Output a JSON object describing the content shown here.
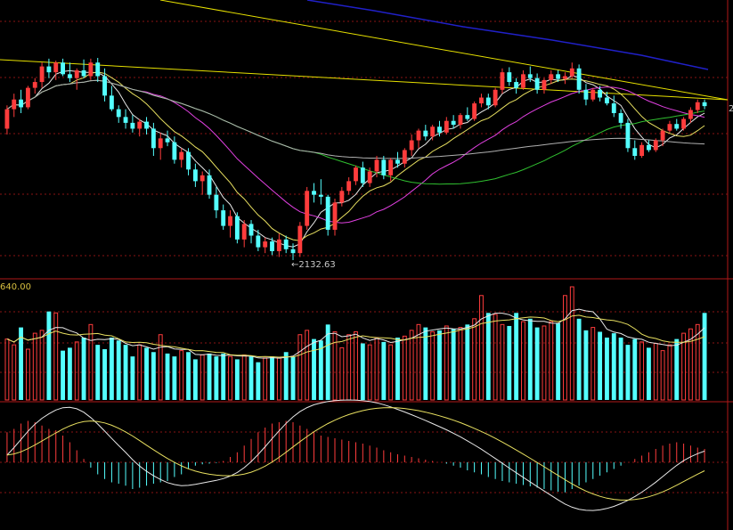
{
  "chart_data": [
    {
      "type": "candlestick",
      "panel": "price",
      "low_marker_text": "←2132.63",
      "right_edge_label": "2",
      "colors": {
        "up": "#ff3c3c",
        "down": "#54ffff",
        "ma5": "#e8e8e8",
        "ma10": "#e8e060",
        "ma20": "#e040e0",
        "ma60": "#30c030",
        "ma120": "#b0b0b0",
        "trend_yellow": "#e6e000",
        "trend_blue": "#2020c8"
      },
      "ohlc": [
        [
          2470,
          2530,
          2455,
          2520
        ],
        [
          2520,
          2560,
          2500,
          2545
        ],
        [
          2545,
          2570,
          2510,
          2525
        ],
        [
          2525,
          2580,
          2520,
          2575
        ],
        [
          2575,
          2600,
          2560,
          2590
        ],
        [
          2590,
          2640,
          2575,
          2630
        ],
        [
          2630,
          2650,
          2600,
          2615
        ],
        [
          2615,
          2645,
          2595,
          2640
        ],
        [
          2640,
          2650,
          2605,
          2610
        ],
        [
          2610,
          2640,
          2590,
          2600
        ],
        [
          2600,
          2625,
          2570,
          2620
        ],
        [
          2620,
          2648,
          2600,
          2605
        ],
        [
          2605,
          2650,
          2595,
          2640
        ],
        [
          2640,
          2652,
          2590,
          2605
        ],
        [
          2605,
          2625,
          2540,
          2555
        ],
        [
          2555,
          2580,
          2515,
          2520
        ],
        [
          2520,
          2530,
          2485,
          2500
        ],
        [
          2500,
          2520,
          2470,
          2485
        ],
        [
          2485,
          2505,
          2460,
          2470
        ],
        [
          2470,
          2495,
          2450,
          2488
        ],
        [
          2488,
          2500,
          2455,
          2470
        ],
        [
          2470,
          2485,
          2400,
          2420
        ],
        [
          2420,
          2460,
          2390,
          2445
        ],
        [
          2445,
          2465,
          2425,
          2435
        ],
        [
          2435,
          2450,
          2380,
          2390
        ],
        [
          2390,
          2420,
          2370,
          2410
        ],
        [
          2410,
          2420,
          2350,
          2365
        ],
        [
          2365,
          2380,
          2320,
          2335
        ],
        [
          2335,
          2360,
          2300,
          2350
        ],
        [
          2350,
          2365,
          2290,
          2300
        ],
        [
          2300,
          2320,
          2240,
          2260
        ],
        [
          2260,
          2275,
          2210,
          2220
        ],
        [
          2220,
          2260,
          2190,
          2245
        ],
        [
          2245,
          2255,
          2175,
          2185
        ],
        [
          2185,
          2235,
          2165,
          2225
        ],
        [
          2225,
          2235,
          2175,
          2195
        ],
        [
          2195,
          2210,
          2155,
          2165
        ],
        [
          2165,
          2190,
          2150,
          2180
        ],
        [
          2180,
          2190,
          2145,
          2155
        ],
        [
          2155,
          2200,
          2140,
          2185
        ],
        [
          2185,
          2195,
          2150,
          2160
        ],
        [
          2160,
          2175,
          2132,
          2150
        ],
        [
          2150,
          2230,
          2140,
          2220
        ],
        [
          2220,
          2320,
          2210,
          2310
        ],
        [
          2310,
          2330,
          2280,
          2300
        ],
        [
          2300,
          2340,
          2275,
          2295
        ],
        [
          2295,
          2300,
          2195,
          2210
        ],
        [
          2210,
          2290,
          2195,
          2280
        ],
        [
          2280,
          2320,
          2270,
          2310
        ],
        [
          2310,
          2345,
          2300,
          2335
        ],
        [
          2335,
          2375,
          2325,
          2370
        ],
        [
          2370,
          2385,
          2320,
          2330
        ],
        [
          2330,
          2370,
          2320,
          2360
        ],
        [
          2360,
          2400,
          2345,
          2390
        ],
        [
          2390,
          2400,
          2340,
          2350
        ],
        [
          2350,
          2395,
          2335,
          2390
        ],
        [
          2390,
          2410,
          2370,
          2380
        ],
        [
          2380,
          2420,
          2370,
          2415
        ],
        [
          2415,
          2455,
          2400,
          2440
        ],
        [
          2440,
          2470,
          2420,
          2465
        ],
        [
          2465,
          2480,
          2440,
          2450
        ],
        [
          2450,
          2480,
          2440,
          2475
        ],
        [
          2475,
          2490,
          2450,
          2460
        ],
        [
          2460,
          2500,
          2455,
          2490
        ],
        [
          2490,
          2505,
          2470,
          2480
        ],
        [
          2480,
          2510,
          2470,
          2505
        ],
        [
          2505,
          2525,
          2490,
          2495
        ],
        [
          2495,
          2540,
          2490,
          2535
        ],
        [
          2535,
          2560,
          2525,
          2550
        ],
        [
          2550,
          2560,
          2520,
          2530
        ],
        [
          2530,
          2575,
          2525,
          2570
        ],
        [
          2570,
          2625,
          2560,
          2615
        ],
        [
          2615,
          2628,
          2580,
          2590
        ],
        [
          2590,
          2600,
          2560,
          2575
        ],
        [
          2575,
          2620,
          2570,
          2610
        ],
        [
          2610,
          2630,
          2590,
          2600
        ],
        [
          2600,
          2612,
          2560,
          2570
        ],
        [
          2570,
          2600,
          2560,
          2595
        ],
        [
          2595,
          2620,
          2585,
          2610
        ],
        [
          2610,
          2620,
          2590,
          2598
        ],
        [
          2598,
          2615,
          2585,
          2605
        ],
        [
          2605,
          2640,
          2600,
          2625
        ],
        [
          2625,
          2635,
          2560,
          2570
        ],
        [
          2570,
          2585,
          2530,
          2545
        ],
        [
          2545,
          2575,
          2540,
          2570
        ],
        [
          2570,
          2580,
          2540,
          2550
        ],
        [
          2550,
          2565,
          2530,
          2535
        ],
        [
          2535,
          2555,
          2500,
          2510
        ],
        [
          2510,
          2520,
          2470,
          2485
        ],
        [
          2485,
          2495,
          2410,
          2420
        ],
        [
          2420,
          2440,
          2390,
          2400
        ],
        [
          2400,
          2435,
          2395,
          2428
        ],
        [
          2428,
          2440,
          2410,
          2415
        ],
        [
          2415,
          2445,
          2410,
          2440
        ],
        [
          2440,
          2470,
          2425,
          2465
        ],
        [
          2465,
          2490,
          2460,
          2482
        ],
        [
          2482,
          2495,
          2465,
          2470
        ],
        [
          2470,
          2500,
          2465,
          2495
        ],
        [
          2495,
          2525,
          2485,
          2518
        ],
        [
          2518,
          2545,
          2510,
          2538
        ],
        [
          2538,
          2545,
          2520,
          2528
        ]
      ]
    },
    {
      "type": "bar",
      "panel": "volume",
      "axis_label": "640.00",
      "values": [
        420,
        380,
        500,
        350,
        460,
        480,
        610,
        600,
        340,
        360,
        400,
        430,
        520,
        380,
        350,
        430,
        410,
        380,
        300,
        380,
        360,
        330,
        450,
        320,
        300,
        340,
        330,
        280,
        310,
        320,
        300,
        320,
        300,
        280,
        310,
        300,
        260,
        290,
        300,
        290,
        330,
        300,
        450,
        480,
        420,
        410,
        520,
        470,
        360,
        450,
        470,
        390,
        380,
        430,
        400,
        380,
        430,
        440,
        480,
        520,
        500,
        470,
        480,
        510,
        490,
        500,
        520,
        560,
        720,
        600,
        590,
        520,
        510,
        600,
        540,
        560,
        500,
        510,
        540,
        530,
        720,
        780,
        560,
        480,
        500,
        470,
        430,
        460,
        430,
        380,
        420,
        400,
        360,
        390,
        340,
        380,
        420,
        460,
        490,
        520,
        600
      ]
    },
    {
      "type": "bar",
      "panel": "macd",
      "values": [
        45,
        50,
        58,
        62,
        60,
        55,
        50,
        48,
        40,
        30,
        18,
        5,
        -8,
        -18,
        -25,
        -30,
        -32,
        -35,
        -40,
        -38,
        -35,
        -32,
        -30,
        -28,
        -22,
        -18,
        -10,
        -5,
        -3,
        -2,
        -1,
        2,
        8,
        15,
        25,
        35,
        45,
        52,
        58,
        60,
        62,
        60,
        55,
        50,
        45,
        40,
        38,
        36,
        34,
        32,
        30,
        28,
        25,
        22,
        18,
        15,
        12,
        10,
        8,
        6,
        4,
        2,
        0,
        -2,
        -5,
        -8,
        -12,
        -15,
        -18,
        -22,
        -25,
        -28,
        -30,
        -32,
        -34,
        -36,
        -38,
        -40,
        -42,
        -44,
        -45,
        -40,
        -35,
        -30,
        -25,
        -20,
        -15,
        -10,
        -5,
        0,
        5,
        10,
        15,
        20,
        25,
        28,
        30,
        28,
        25,
        22,
        20
      ]
    }
  ]
}
